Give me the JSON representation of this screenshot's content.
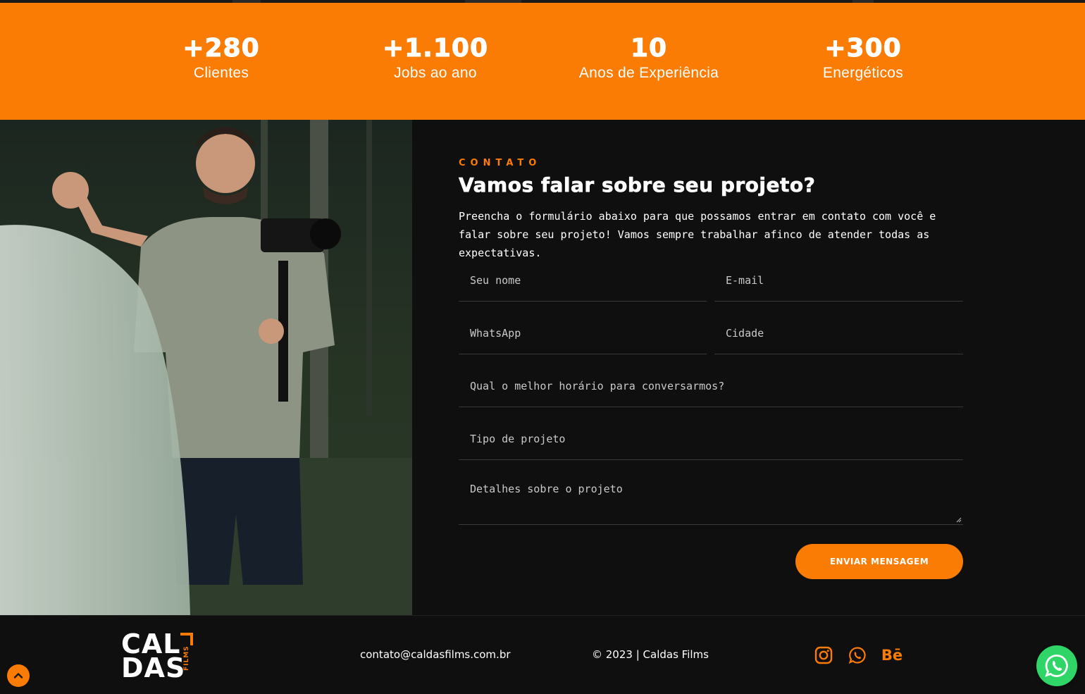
{
  "stats": [
    {
      "value": "+280",
      "label": "Clientes"
    },
    {
      "value": "+1.100",
      "label": "Jobs ao ano"
    },
    {
      "value": "10",
      "label": "Anos de Experiência"
    },
    {
      "value": "+300",
      "label": "Energéticos"
    }
  ],
  "contact": {
    "eyebrow": "CONTATO",
    "heading": "Vamos falar sobre seu projeto?",
    "intro": "Preencha o formulário abaixo para que possamos entrar em contato com você e falar sobre seu projeto! Vamos sempre trabalhar afinco de atender todas as expectativas.",
    "fields": {
      "name": {
        "placeholder": "Seu nome",
        "value": ""
      },
      "email": {
        "placeholder": "E-mail",
        "value": ""
      },
      "whatsapp": {
        "placeholder": "WhatsApp",
        "value": ""
      },
      "city": {
        "placeholder": "Cidade",
        "value": ""
      },
      "best_time": {
        "placeholder": "Qual o melhor horário para conversarmos?",
        "value": ""
      },
      "project_type": {
        "placeholder": "Tipo de projeto",
        "value": ""
      },
      "details": {
        "placeholder": "Detalhes sobre o projeto",
        "value": ""
      }
    },
    "submit_label": "ENVIAR MENSAGEM"
  },
  "footer": {
    "logo": {
      "line1": "CAL",
      "line2": "DAS",
      "sub": "FILMS"
    },
    "email": "contato@caldasfilms.com.br",
    "copyright": "© 2023 | Caldas Films",
    "social": {
      "behance": "Bē"
    }
  },
  "colors": {
    "accent": "#fb7c04",
    "background": "#0f0f0f",
    "whatsapp": "#2fd667"
  },
  "icons": [
    "instagram-icon",
    "whatsapp-icon",
    "behance-icon",
    "chevron-up-icon",
    "whatsapp-float-icon"
  ]
}
